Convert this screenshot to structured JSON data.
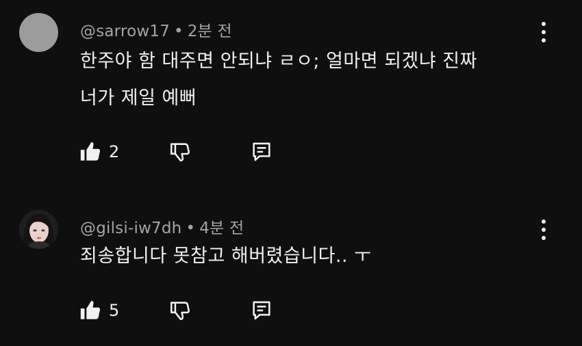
{
  "comments": [
    {
      "username": "@sarrow17",
      "separator": "•",
      "time": "2분 전",
      "lines": [
        "한주야 함 대주면 안되냐 ㄹㅇ; 얼마면 되겠냐 진짜",
        "너가 제일 예뻐"
      ],
      "likes": "2",
      "avatar_color": "#9b9b9b"
    },
    {
      "username": "@gilsi-iw7dh",
      "separator": "•",
      "time": "4분 전",
      "lines": [
        "죄송합니다 못참고 해버렸습니다.. ㅜ"
      ],
      "likes": "5"
    }
  ],
  "icons": {
    "like": "thumbs-up-icon",
    "dislike": "thumbs-down-icon",
    "reply": "reply-icon",
    "more": "more-vertical-icon"
  }
}
